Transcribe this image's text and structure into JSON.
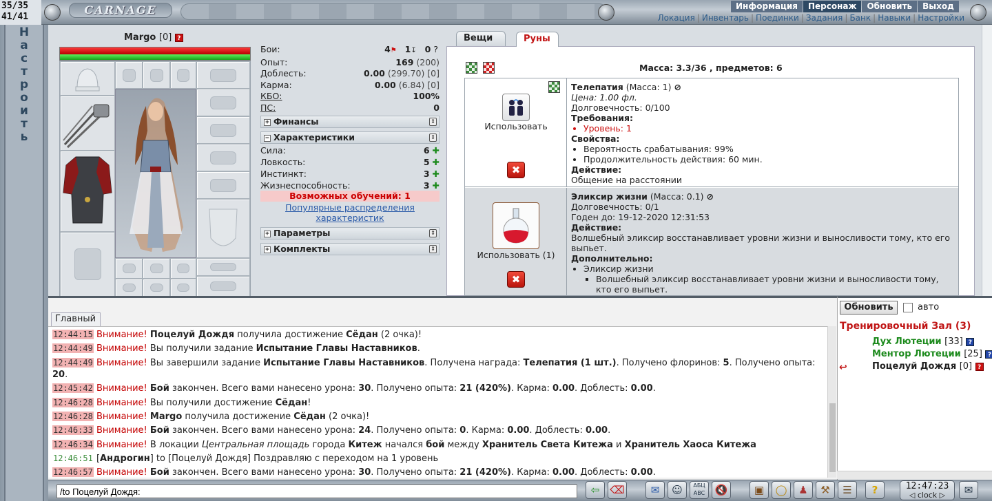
{
  "counters": {
    "hp": "35/35",
    "mana": "41/41"
  },
  "logo": "CARNAGE",
  "nav": {
    "main": [
      {
        "label": "Информация",
        "active": false
      },
      {
        "label": "Персонаж",
        "active": true
      },
      {
        "label": "Обновить",
        "active": false
      },
      {
        "label": "Выход",
        "active": false
      }
    ],
    "sub": [
      "Локация",
      "Инвентарь",
      "Поединки",
      "Задания",
      "Банк",
      "Навыки",
      "Настройки"
    ]
  },
  "sidebar": {
    "letters": [
      "Н",
      "а",
      "с",
      "т",
      "р",
      "о",
      "и",
      "т",
      "ь"
    ]
  },
  "character": {
    "name": "Margo",
    "level": "[0]",
    "info_badge": "?",
    "fights_label": "Бои:",
    "fights_wins": "4",
    "fights_losses": "1",
    "fights_draws": "0",
    "fights_unknown": "?",
    "stats": [
      {
        "label": "Опыт:",
        "value": "169",
        "extra": "(200)"
      },
      {
        "label": "Доблесть:",
        "value": "0.00",
        "extra": "(299.70) [0]"
      },
      {
        "label": "Карма:",
        "value": "0.00",
        "extra": "(6.84) [0]"
      },
      {
        "label": "КБО:",
        "value": "100%",
        "extra": ""
      },
      {
        "label": "ПС:",
        "value": "0",
        "extra": ""
      }
    ],
    "sections": {
      "finances": "Финансы",
      "characteristics": "Характеристики",
      "parameters": "Параметры",
      "sets": "Комплекты"
    },
    "attributes": [
      {
        "label": "Сила:",
        "value": "6"
      },
      {
        "label": "Ловкость:",
        "value": "5"
      },
      {
        "label": "Инстинкт:",
        "value": "3"
      },
      {
        "label": "Жизнеспособность:",
        "value": "3"
      }
    ],
    "learn_points": "Возможных обучений: 1",
    "popular_link": "Популярные распределения характеристик"
  },
  "inventory": {
    "tabs": {
      "items": "Вещи",
      "runes": "Руны"
    },
    "mass": "Масса: 3.3/36 , предметов: 6",
    "items": [
      {
        "name": "Телепатия",
        "mass": "(Масса: 1)",
        "price": "Цена: 1.00 фл.",
        "durability": "Долговечность: 0/100",
        "requirements_title": "Требования:",
        "requirements": [
          "Уровень: 1"
        ],
        "properties_title": "Свойства:",
        "properties": [
          "Вероятность срабатывания: 99%",
          "Продолжительность действия: 60 мин."
        ],
        "action_title": "Действие:",
        "action": "Общение на расстоянии",
        "use_label": "Использовать",
        "icon": "telepathy-icon"
      },
      {
        "name": "Эликсир жизни",
        "mass": "(Масса: 0.1)",
        "durability": "Долговечность: 0/1",
        "valid": "Годен до: 19-12-2020 12:31:53",
        "action_title": "Действие:",
        "action": "Волшебный эликсир восстанавливает уровни жизни и выносливости тому, кто его выпьет.",
        "extra_title": "Дополнительно:",
        "extra_item": "Эликсир жизни",
        "extra_sub": "Волшебный эликсир восстанавливает уровни жизни и выносливости тому, кто его выпьет.",
        "use_label": "Использовать (1)",
        "icon": "elixir-flask-icon"
      }
    ]
  },
  "chat": {
    "tab": "Главный",
    "input_value": "/to Поцелуй Дождя:",
    "messages": [
      {
        "time": "12:44:15",
        "type": "warn",
        "html": "<b>Поцелуй Дождя</b> получила достижение <b>Сёдан</b> (2 очка)!"
      },
      {
        "time": "12:44:49",
        "type": "warn",
        "html": "Вы получили задание <b>Испытание Главы Наставников</b>."
      },
      {
        "time": "12:44:49",
        "type": "warn",
        "html": "Вы завершили задание <b>Испытание Главы Наставников</b>. Получена награда: <b>Телепатия (1 шт.)</b>. Получено флоринов: <b>5</b>. Получено опыта: <b>20</b>."
      },
      {
        "time": "12:45:42",
        "type": "warn",
        "html": "<b>Бой</b> закончен. Всего вами нанесено урона: <b>30</b>. Получено опыта: <b>21 (420%)</b>. Карма: <b>0.00</b>. Доблесть: <b>0.00</b>."
      },
      {
        "time": "12:46:28",
        "type": "warn",
        "html": "Вы получили достижение <b>Сёдан</b>!"
      },
      {
        "time": "12:46:28",
        "type": "warn",
        "html": "<b>Margo</b> получила достижение <b>Сёдан</b> (2 очка)!"
      },
      {
        "time": "12:46:33",
        "type": "warn",
        "html": "<b>Бой</b> закончен. Всего вами нанесено урона: <b>24</b>. Получено опыта: <b>0</b>. Карма: <b>0.00</b>. Доблесть: <b>0.00</b>."
      },
      {
        "time": "12:46:34",
        "type": "warn",
        "html": "В локации <i>Центральная площадь</i> города <b>Китеж</b> начался <b>бой</b> между <b>Хранитель Света Китежа</b> и <b>Хранитель Хаоса Китежа</b>"
      },
      {
        "time": "12:46:51",
        "type": "private",
        "html": "[<b>Андрогин</b>] to [Поцелуй Дождя] Поздравляю с переходом на 1 уровень"
      },
      {
        "time": "12:46:57",
        "type": "warn",
        "html": "<b>Бой</b> закончен. Всего вами нанесено урона: <b>30</b>. Получено опыта: <b>21 (420%)</b>. Карма: <b>0.00</b>. Доблесть: <b>0.00</b>."
      }
    ],
    "warn_label": "Внимание!"
  },
  "users": {
    "refresh_label": "Обновить",
    "auto_label": "авто",
    "room": "Тренировочный Зал (3)",
    "list": [
      {
        "name": "Дух Лютеции",
        "level": "[33]",
        "color": "#1c8a1c",
        "badge": "bot"
      },
      {
        "name": "Ментор Лютеции",
        "level": "[25]",
        "color": "#1c8a1c",
        "badge": "bot"
      },
      {
        "name": "Поцелуй Дождя",
        "level": "[0]",
        "color": "#222222",
        "badge": "info"
      }
    ]
  },
  "clock": {
    "time": "12:47:23",
    "label": "clock"
  },
  "colors": {
    "accent_red": "#c21414",
    "nav_active": "#2e4964",
    "link": "#2a5aa8"
  }
}
